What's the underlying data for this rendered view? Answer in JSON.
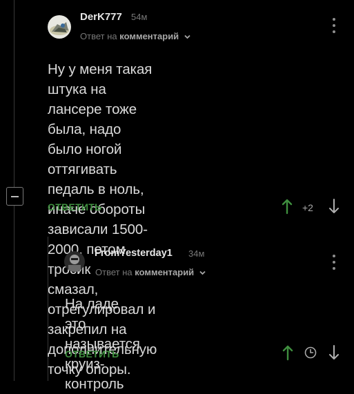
{
  "comments": [
    {
      "username": "DerK777",
      "time": "54м",
      "reply_prefix": "Ответ на",
      "reply_target": "комментарий",
      "text_lines": [
        "Ну у меня такая штука на лансере тоже",
        "была, надо было ногой оттягивать",
        "педаль в ноль, иначе обороты",
        "зависали 1500-2000, потом тросик",
        "смазал, отрегулировал и закрепил на",
        "дополнительную точку опоры."
      ],
      "reply_label": "ОТВЕТИТЬ",
      "rating": "+2"
    },
    {
      "username": "FromYesterday1",
      "time": "34м",
      "reply_prefix": "Ответ на",
      "reply_target": "комментарий",
      "text_lines": [
        "На ладе это называется",
        "круиз-контроль"
      ],
      "reply_label": "ОТВЕТИТЬ"
    }
  ],
  "colors": {
    "background": "#000000",
    "accent_green": "#3f8f3f",
    "muted_text": "#777777"
  },
  "icons": [
    "collapse-minus-icon",
    "kebab-menu-icon",
    "chevron-down-icon",
    "arrow-up-icon",
    "arrow-down-icon",
    "clock-icon"
  ]
}
